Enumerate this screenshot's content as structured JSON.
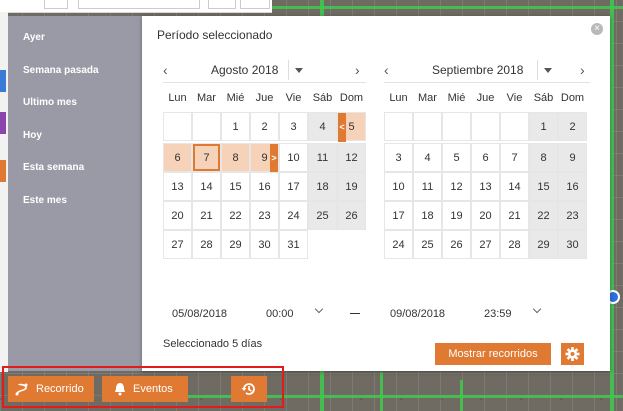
{
  "sidebar": {
    "items": [
      {
        "label": "Ayer"
      },
      {
        "label": "Semana pasada"
      },
      {
        "label": "Ultimo mes"
      },
      {
        "label": "Hoy"
      },
      {
        "label": "Esta semana"
      },
      {
        "label": "Este mes"
      }
    ]
  },
  "panel": {
    "title": "Período seleccionado",
    "close_icon": "close-icon"
  },
  "calendar_left": {
    "month": "Agosto 2018",
    "prev": "‹",
    "next": "›",
    "days_of_week": [
      "Lun",
      "Mar",
      "Mié",
      "Jue",
      "Vie",
      "Sáb",
      "Dom"
    ],
    "rows": [
      [
        "",
        "",
        "1",
        "2",
        "3",
        "4",
        "5"
      ],
      [
        "6",
        "7",
        "8",
        "9",
        "10",
        "11",
        "12"
      ],
      [
        "13",
        "14",
        "15",
        "16",
        "17",
        "18",
        "19"
      ],
      [
        "20",
        "21",
        "22",
        "23",
        "24",
        "25",
        "26"
      ],
      [
        "27",
        "28",
        "29",
        "30",
        "31",
        "",
        ""
      ]
    ],
    "range_start_marker": "<",
    "range_end_marker": ">"
  },
  "calendar_right": {
    "month": "Septiembre 2018",
    "prev": "‹",
    "next": "›",
    "days_of_week": [
      "Lun",
      "Mar",
      "Mié",
      "Jue",
      "Vie",
      "Sáb",
      "Dom"
    ],
    "rows": [
      [
        "",
        "",
        "",
        "",
        "",
        "1",
        "2"
      ],
      [
        "3",
        "4",
        "5",
        "6",
        "7",
        "8",
        "9"
      ],
      [
        "10",
        "11",
        "12",
        "13",
        "14",
        "15",
        "16"
      ],
      [
        "17",
        "18",
        "19",
        "20",
        "21",
        "22",
        "23"
      ],
      [
        "24",
        "25",
        "26",
        "27",
        "28",
        "29",
        "30"
      ]
    ]
  },
  "range": {
    "start_date": "05/08/2018",
    "start_time": "00:00",
    "end_date": "09/08/2018",
    "end_time": "23:59",
    "separator": "—",
    "summary": "Seleccionado 5 días"
  },
  "actions": {
    "show_routes": "Mostrar recorridos",
    "settings_icon": "gear-icon"
  },
  "bottom_bar": {
    "recorrido": "Recorrido",
    "eventos": "Eventos",
    "history_icon": "history-icon"
  },
  "colors": {
    "accent": "#e07a33",
    "range_fill": "#f6d2b8",
    "sidebar": "#9a9aa6",
    "highlight_box": "#e21b1b"
  }
}
